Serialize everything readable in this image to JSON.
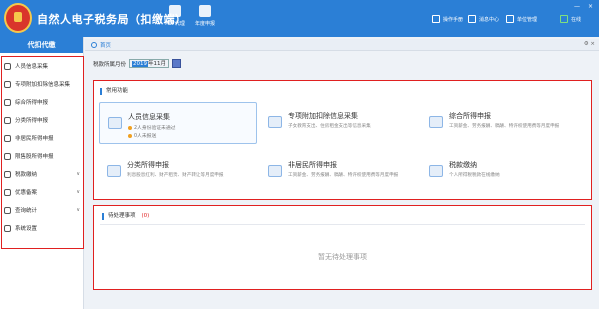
{
  "header": {
    "title": "自然人电子税务局（扣缴端）",
    "toolbar": [
      {
        "label": "PDF代理",
        "icon": "pdf-icon"
      },
      {
        "label": "年度申报",
        "icon": "document-icon"
      }
    ],
    "right_links": [
      {
        "label": "操作手册",
        "icon": "manual-icon"
      },
      {
        "label": "消息中心",
        "icon": "message-icon"
      },
      {
        "label": "单位管理",
        "icon": "company-icon"
      },
      {
        "label": "在线",
        "icon": "online-icon"
      }
    ],
    "window_controls": [
      "—",
      "×"
    ]
  },
  "sidebar": {
    "header": "代扣代缴",
    "items": [
      {
        "label": "人员信息采集",
        "icon": "person-icon"
      },
      {
        "label": "专项附加扣除信息采集",
        "icon": "list-icon"
      },
      {
        "label": "综合所得申报",
        "icon": "stack-icon"
      },
      {
        "label": "分类所得申报",
        "icon": "clock-icon"
      },
      {
        "label": "非居民所得申报",
        "icon": "user-icon"
      },
      {
        "label": "限售股所得申报",
        "icon": "chart-icon"
      },
      {
        "label": "税款缴纳",
        "icon": "coin-icon",
        "expandable": true
      },
      {
        "label": "优惠备案",
        "icon": "doc-icon",
        "expandable": true
      },
      {
        "label": "查询统计",
        "icon": "search-icon",
        "expandable": true
      },
      {
        "label": "系统设置",
        "icon": "gear-icon"
      }
    ]
  },
  "tabs": [
    {
      "label": "首页"
    }
  ],
  "period": {
    "label": "税款所属月份",
    "year": "2019",
    "month": "年11月"
  },
  "common": {
    "title": "常用功能",
    "cards": [
      {
        "title": "人员信息采集",
        "stat1": "2人身份验证未通过",
        "stat2": "0人未报送"
      },
      {
        "title": "专项附加扣除信息采集",
        "desc": "子女教育支出、住房租金支出等信息采集"
      },
      {
        "title": "综合所得申报",
        "desc": "工资薪金、劳务报酬、稿酬、特许权使用费等月度申报"
      },
      {
        "title": "分类所得申报",
        "desc": "利息股息红利、财产租赁、财产转让等月度申报"
      },
      {
        "title": "非居民所得申报",
        "desc": "工资薪金、劳务报酬、稿酬、特许权使用费等月度申报"
      },
      {
        "title": "税款缴纳",
        "desc": "个人所得税税款在线缴纳"
      }
    ]
  },
  "pending": {
    "title": "待处理事项",
    "count": "(0)",
    "empty": "暂无待处理事项"
  }
}
